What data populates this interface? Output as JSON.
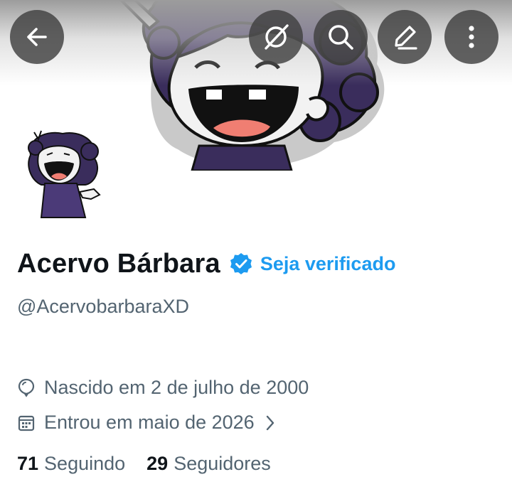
{
  "header": {
    "back_label": "Voltar",
    "icons": [
      "arrow-left-icon",
      "grok-icon",
      "search-icon",
      "pencil-icon",
      "more-vertical-icon"
    ]
  },
  "profile": {
    "display_name": "Acervo Bárbara",
    "verify_cta": "Seja verificado",
    "handle": "@AcervobarbaraXD",
    "birth": "Nascido em 2 de julho de 2000",
    "joined": "Entrou em maio de 2026",
    "following_count": "71",
    "following_label": "Seguindo",
    "followers_count": "29",
    "followers_label": "Seguidores"
  },
  "colors": {
    "accent": "#1d9bf0",
    "text_primary": "#0f1419",
    "text_secondary": "#536471",
    "hair": "#3a2d5c",
    "dress": "#4b3a78"
  }
}
